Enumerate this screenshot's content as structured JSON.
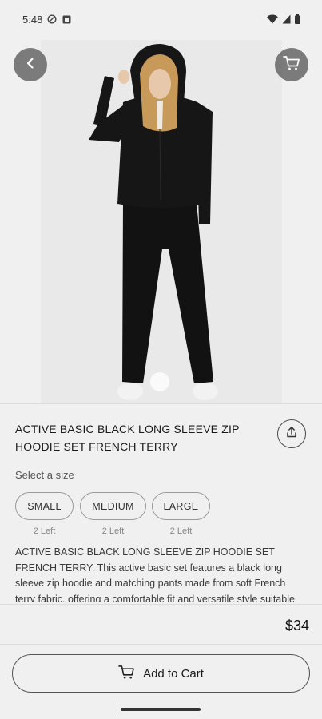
{
  "status_bar": {
    "time": "5:48",
    "left_icons": [
      "do-not-disturb-icon",
      "notification-app-icon"
    ],
    "right_icons": [
      "wifi-icon",
      "signal-icon",
      "battery-icon"
    ]
  },
  "product": {
    "title": "ACTIVE BASIC BLACK LONG SLEEVE ZIP HOODIE SET FRENCH TERRY",
    "description": "ACTIVE BASIC BLACK LONG SLEEVE ZIP HOODIE SET FRENCH TERRY. This active basic set features a black long sleeve zip hoodie and matching pants made from soft French terry fabric, offering a comfortable fit and versatile style suitable",
    "price": "$34"
  },
  "sizes": {
    "label": "Select a size",
    "options": [
      {
        "label": "SMALL",
        "stock": "2 Left"
      },
      {
        "label": "MEDIUM",
        "stock": "2 Left"
      },
      {
        "label": "LARGE",
        "stock": "2 Left"
      }
    ]
  },
  "actions": {
    "add_to_cart": "Add to Cart"
  },
  "colors": {
    "background": "#f0f0f0",
    "image_background": "#e9e9ea",
    "overlay_button": "#5a5a5a",
    "outline": "#9a9a9a"
  }
}
